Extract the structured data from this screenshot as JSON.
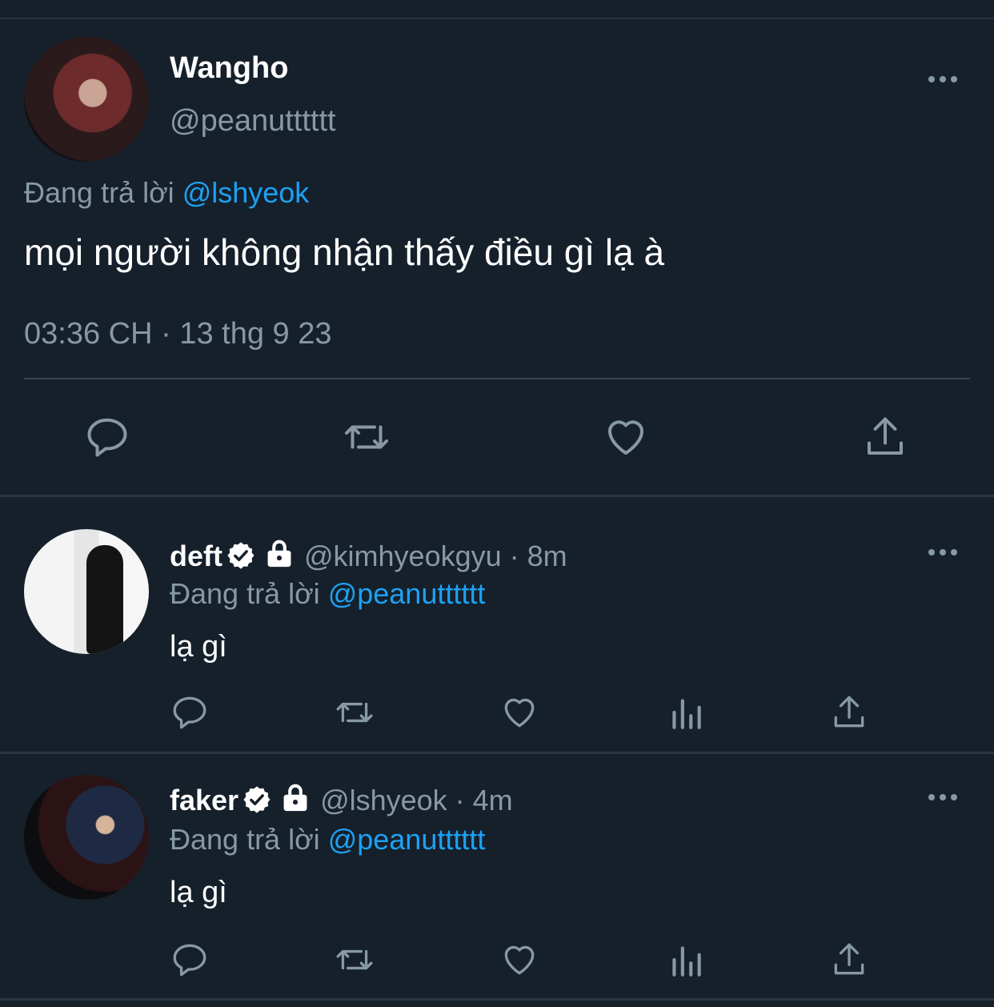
{
  "main_tweet": {
    "author_name": "Wangho",
    "author_handle": "@peanutttttt",
    "replying_prefix": "Đang trả lời ",
    "replying_to": "@lshyeok",
    "text": "mọi người không nhận thấy điều gì lạ à",
    "timestamp": "03:36 CH · 13 thg 9 23",
    "actions": [
      "reply-icon",
      "retweet-icon",
      "like-icon",
      "share-icon"
    ]
  },
  "replies": [
    {
      "name": "deft",
      "verified": true,
      "protected": true,
      "meta": "@kimhyeokgyu · 8m",
      "replying_prefix": "Đang trả lời ",
      "replying_to": "@peanutttttt",
      "text": "lạ gì",
      "actions": [
        "reply-icon",
        "retweet-icon",
        "like-icon",
        "analytics-icon",
        "share-icon"
      ]
    },
    {
      "name": "faker",
      "verified": true,
      "protected": true,
      "meta": "@lshyeok · 4m",
      "replying_prefix": "Đang trả lời ",
      "replying_to": "@peanutttttt",
      "text": "lạ gì",
      "actions": [
        "reply-icon",
        "retweet-icon",
        "like-icon",
        "analytics-icon",
        "share-icon"
      ]
    }
  ],
  "colors": {
    "background": "#15202b",
    "secondary_text": "#8899a6",
    "link": "#1da1f2",
    "divider": "#38444d"
  }
}
